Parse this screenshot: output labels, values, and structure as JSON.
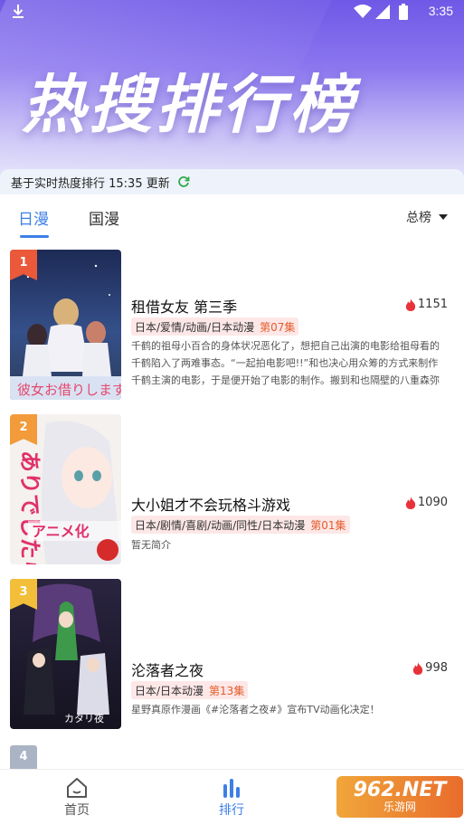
{
  "status_bar": {
    "time": "3:35"
  },
  "banner": {
    "title": "热搜排行榜"
  },
  "update_bar": {
    "text": "基于实时热度排行 15:35 更新"
  },
  "tabs": {
    "items": [
      {
        "label": "日漫",
        "active": true
      },
      {
        "label": "国漫",
        "active": false
      }
    ]
  },
  "rank_select": {
    "label": "总榜"
  },
  "items": [
    {
      "rank": "1",
      "badge_color": "#e9593a",
      "title": "租借女友 第三季",
      "heat": "1151",
      "tags": "日本/爱情/动画/日本动漫",
      "episode": "第07集",
      "description": "千鹤的祖母小百合的身体状况恶化了，想把自己出演的电影给祖母看的千鹤陷入了两难事态。“一起拍电影吧!!”和也决心用众筹的方式来制作千鹤主演的电影，于是便开始了电影的制作。搬到和也隔壁的八重森弥妮也…"
    },
    {
      "rank": "2",
      "badge_color": "#f39a3a",
      "title": "大小姐才不会玩格斗游戏",
      "heat": "1090",
      "tags": "日本/剧情/喜剧/动画/同性/日本动漫",
      "episode": "第01集",
      "description": "暂无简介"
    },
    {
      "rank": "3",
      "badge_color": "#f3bf3a",
      "title": "沦落者之夜",
      "heat": "998",
      "tags": "日本/日本动漫",
      "episode": "第13集",
      "description": "星野真原作漫画《#沦落者之夜#》宣布TV动画化决定！"
    }
  ],
  "peek_rank": "4",
  "bottom_nav": {
    "home": "首页",
    "rank": "排行"
  },
  "watermark": {
    "top": "962.NET",
    "bottom": "乐游网"
  },
  "colors": {
    "accent": "#3d7fe8",
    "heat": "#e8323a"
  }
}
